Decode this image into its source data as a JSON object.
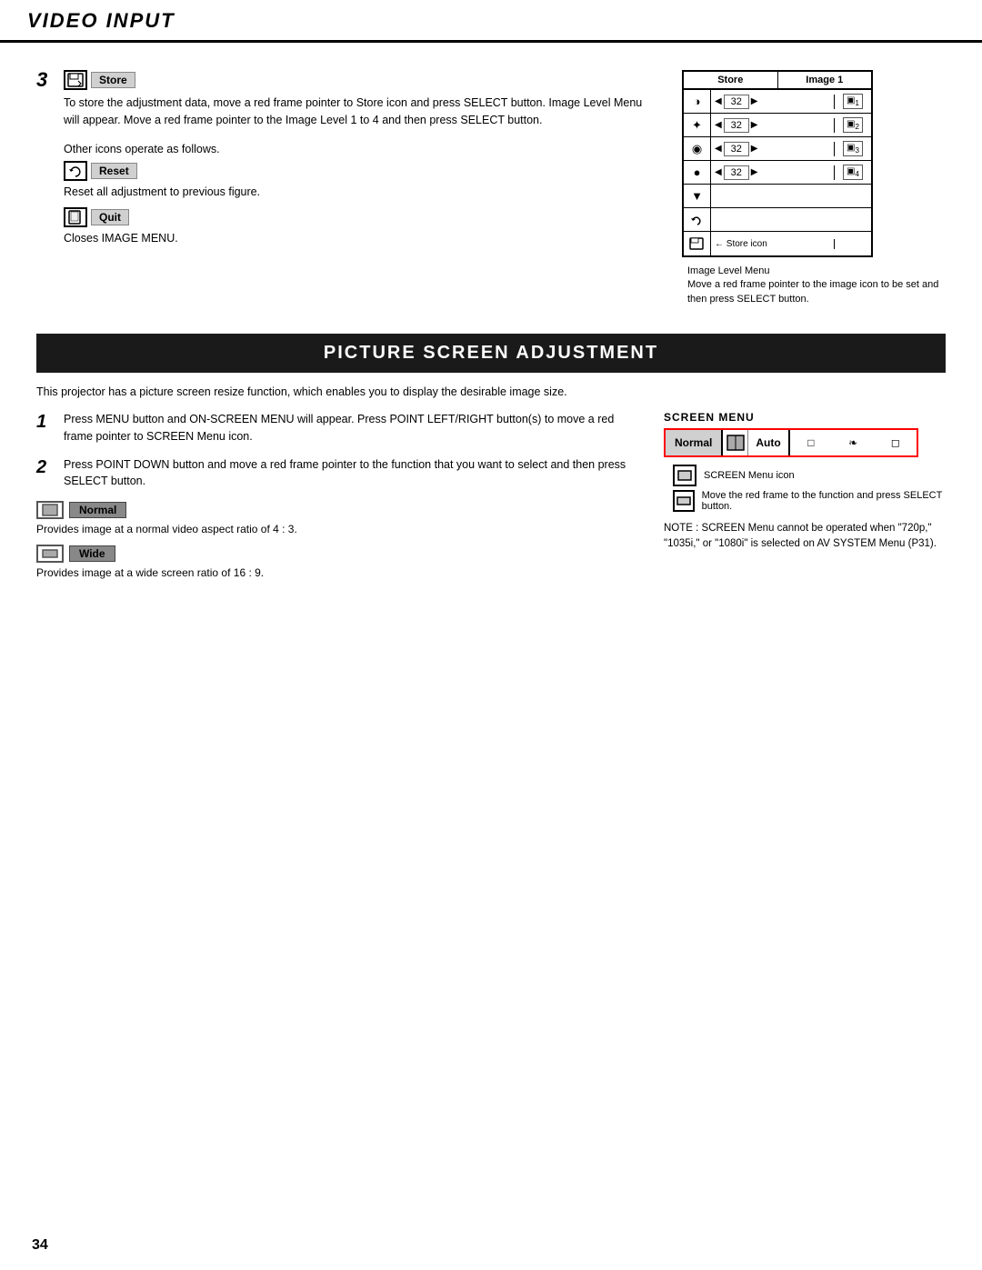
{
  "header": {
    "title": "VIDEO INPUT"
  },
  "store_section": {
    "step_number": "3",
    "store_icon_label": "Store",
    "store_description": "To store the adjustment data, move a red frame pointer to Store icon and press SELECT button.  Image Level Menu will appear.  Move a red frame pointer to the Image Level 1 to 4 and then press SELECT button.",
    "other_icons_text": "Other icons operate as follows.",
    "reset_label": "Reset",
    "reset_description": "Reset all adjustment to previous figure.",
    "quit_label": "Quit",
    "quit_description": "Closes IMAGE MENU.",
    "image_level_menu": {
      "col1": "Store",
      "col2": "Image 1",
      "rows": [
        {
          "icon": "◑",
          "value": "32",
          "level": "▣1"
        },
        {
          "icon": "☀",
          "value": "32",
          "level": "▣2"
        },
        {
          "icon": "◉",
          "value": "32",
          "level": "▣3"
        },
        {
          "icon": "●",
          "value": "32",
          "level": "▣4"
        }
      ],
      "note_title": "Image Level Menu",
      "note_text": "Move a red frame pointer to the image icon to be set and then press SELECT button.",
      "store_icon_note": "Store icon"
    }
  },
  "psa_section": {
    "title": "PICTURE SCREEN ADJUSTMENT",
    "intro": "This projector has a picture screen resize function, which enables you to display the desirable image size.",
    "step1_num": "1",
    "step1_text": "Press MENU button and ON-SCREEN MENU will appear.  Press POINT LEFT/RIGHT button(s) to move a red frame pointer to SCREEN Menu icon.",
    "step2_num": "2",
    "step2_text": "Press POINT DOWN button and move a red frame pointer to the function that you want to select and then press SELECT button.",
    "normal_label": "Normal",
    "normal_desc": "Provides image at a normal video aspect ratio of 4 : 3.",
    "wide_label": "Wide",
    "wide_desc": "Provides image at a wide screen ratio of 16 : 9.",
    "screen_menu": {
      "label": "SCREEN MENU",
      "normal": "Normal",
      "auto": "Auto",
      "icon1": "⊟",
      "icon2": "❧",
      "icon3": "□",
      "row1_label": "SCREEN Menu icon",
      "row2_label": "Move the red frame to the function and press SELECT button."
    },
    "note_text": "NOTE : SCREEN Menu cannot be operated when \"720p,\" \"1035i,\" or \"1080i\" is selected on AV SYSTEM Menu (P31)."
  },
  "page_number": "34"
}
